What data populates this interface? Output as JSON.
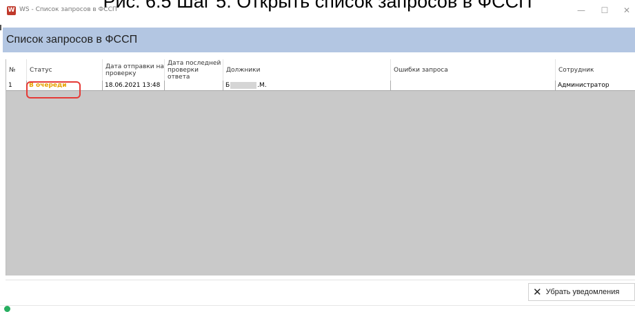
{
  "caption": "Рис. 6.5 Шаг 5. Открыть список запросов в ФССП",
  "window": {
    "app_icon_letter": "W",
    "title": "WS - Список запросов в ФССП",
    "minimize": "—",
    "maximize": "☐",
    "close": "✕"
  },
  "page": {
    "heading": "Список запросов в ФССП"
  },
  "table": {
    "headers": {
      "num": "№",
      "status": "Статус",
      "sent_date": "Дата отправки на проверку",
      "last_check": "Дата последней проверки ответа",
      "debtors": "Должники",
      "errors": "Ошибки запроса",
      "employee": "Сотрудник"
    },
    "rows": [
      {
        "num": "1",
        "status": "В очереди",
        "sent_date": "18.06.2021 13:48",
        "last_check": "",
        "debtor_start": "Б",
        "debtor_end": ".М.",
        "errors": "",
        "employee": "Администратор"
      }
    ]
  },
  "footer": {
    "dismiss_icon": "✕",
    "dismiss_label": "Убрать уведомления"
  },
  "colors": {
    "header_band": "#b3c6e2",
    "status_queue": "#e6a100",
    "highlight": "#e53935"
  }
}
